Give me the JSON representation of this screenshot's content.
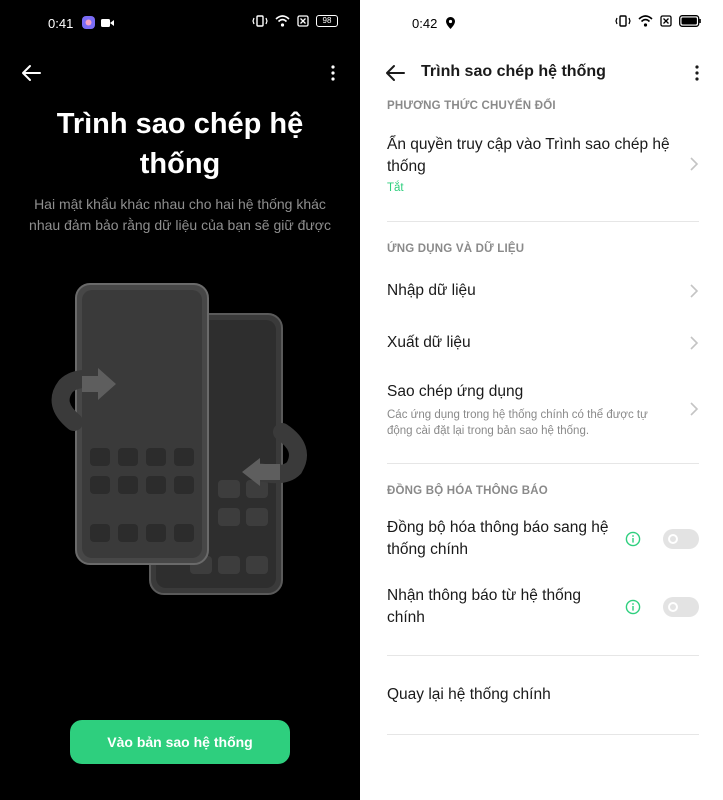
{
  "left": {
    "status": {
      "time": "0:41",
      "battery": "98"
    },
    "heading": "Trình sao chép hệ thống",
    "description": "Hai mật khẩu khác nhau cho hai hệ thống khác nhau đảm bảo rằng dữ liệu của bạn sẽ giữ được",
    "cta_label": "Vào bản sao hệ thống"
  },
  "right": {
    "status": {
      "time": "0:42"
    },
    "title": "Trình sao chép hệ thống",
    "sections": [
      {
        "header": "PHƯƠNG THỨC CHUYỂN ĐỔI",
        "items": [
          {
            "label": "Ẩn quyền truy cập vào Trình sao chép hệ thống",
            "state": "Tắt"
          }
        ]
      },
      {
        "header": "ỨNG DỤNG VÀ DỮ LIỆU",
        "items": [
          {
            "label": "Nhập dữ liệu"
          },
          {
            "label": "Xuất dữ liệu"
          },
          {
            "label": "Sao chép ứng dụng",
            "description": "Các ứng dụng trong hệ thống chính có thể được tự động cài đặt lại trong bản sao hệ thống."
          }
        ]
      },
      {
        "header": "ĐỒNG BỘ HÓA THÔNG BÁO",
        "items": [
          {
            "label": "Đồng bộ hóa thông báo sang hệ thống chính",
            "toggle": false
          },
          {
            "label": "Nhận thông báo từ hệ thống chính",
            "toggle": false
          }
        ]
      }
    ],
    "return_label": "Quay lại hệ thống chính"
  },
  "colors": {
    "accent": "#2ecf7e",
    "dark_bg": "#000000",
    "light_bg": "#ffffff"
  }
}
